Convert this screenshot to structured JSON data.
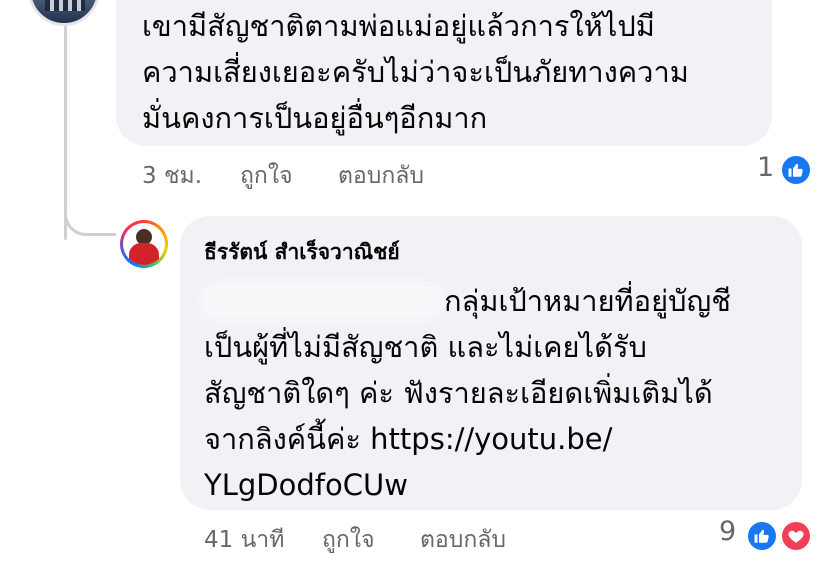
{
  "comment_1": {
    "lines": [
      "เขามีสัญชาติตามพ่อแม่อยู่แล้วการให้ไปมี",
      "ความเสี่ยงเยอะครับไม่ว่าจะเป็นภัยทางความ",
      "มั่นคงการเป็นอยู่อื่นๆอีกมาก"
    ],
    "time": "3 ชม.",
    "like_label": "ถูกใจ",
    "reply_label": "ตอบกลับ",
    "reaction_count": "1",
    "reactions": [
      "like-icon"
    ]
  },
  "comment_2": {
    "author": "ธีรรัตน์ สำเร็จวาณิชย์",
    "lines": [
      "กลุ่มเป้าหมายที่อยู่บัญชี",
      "เป็นผู้ที่ไม่มีสัญชาติ และไม่เคยได้รับ",
      "สัญชาติใดๆ ค่ะ ฟังรายละเอียดเพิ่มเติมได้",
      "จากลิงค์นี้ค่ะ https://youtu.be/",
      "YLgDodfoCUw"
    ],
    "time": "41 นาที",
    "like_label": "ถูกใจ",
    "reply_label": "ตอบกลับ",
    "reaction_count": "9",
    "reactions": [
      "like-icon",
      "love-icon"
    ]
  },
  "colors": {
    "bubble_bg": "#f0f2f5",
    "meta_text": "#65676b",
    "like_blue": "#1877f2",
    "love_red": "#f33e58"
  }
}
